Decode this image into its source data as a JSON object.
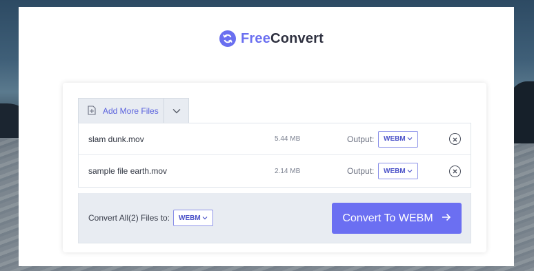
{
  "brand": {
    "prefix": "Free",
    "suffix": "Convert"
  },
  "toolbar": {
    "add_files_label": "Add More Files"
  },
  "files": [
    {
      "name": "slam dunk.mov",
      "size": "5.44 MB",
      "output_label": "Output:",
      "format": "WEBM"
    },
    {
      "name": "sample file earth.mov",
      "size": "2.14 MB",
      "output_label": "Output:",
      "format": "WEBM"
    }
  ],
  "footer": {
    "convert_all_label": "Convert All(2) Files to:",
    "format": "WEBM",
    "convert_button": "Convert To WEBM"
  },
  "colors": {
    "accent": "#6b6ff2",
    "panel": "#e8ecf2"
  }
}
